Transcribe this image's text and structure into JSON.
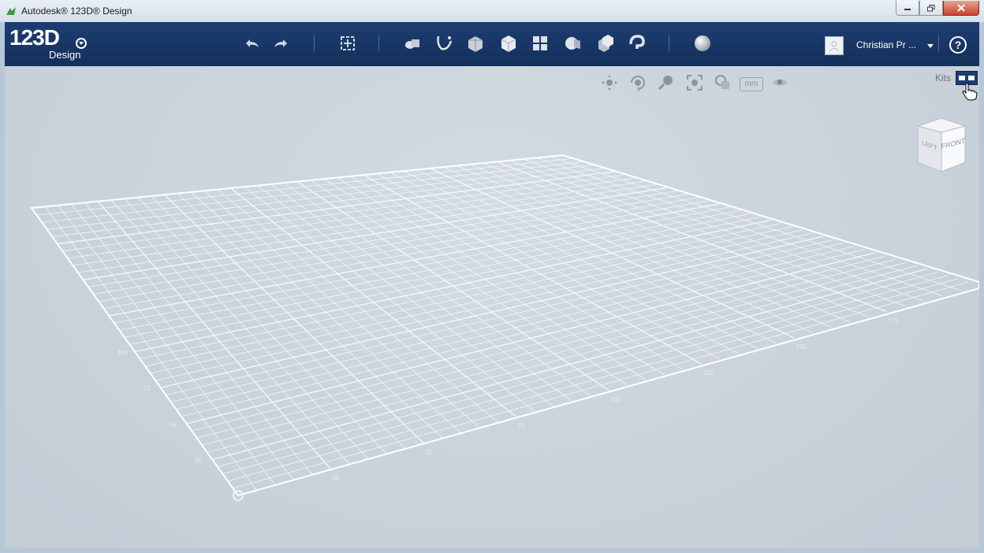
{
  "window": {
    "title": "Autodesk® 123D® Design",
    "controls": [
      "minimize",
      "maximize",
      "close"
    ]
  },
  "logo": {
    "main": "123D",
    "sub": "Design"
  },
  "toolbar": {
    "tools": [
      {
        "name": "undo-icon"
      },
      {
        "name": "redo-icon"
      },
      {
        "name": "transform-icon"
      },
      {
        "name": "primitives-icon"
      },
      {
        "name": "sketch-icon"
      },
      {
        "name": "construct-icon"
      },
      {
        "name": "modify-icon"
      },
      {
        "name": "pattern-icon"
      },
      {
        "name": "grouping-icon"
      },
      {
        "name": "combine-icon"
      },
      {
        "name": "measure-icon"
      },
      {
        "name": "material-icon"
      }
    ]
  },
  "user": {
    "name": "Christian Pr ..."
  },
  "help": {
    "label": "?"
  },
  "viewport": {
    "kits_label": "Kits",
    "units_label": "mm",
    "viewcube": {
      "front": "FRONT",
      "left": "LEFT"
    },
    "grid_labels_right": [
      "25",
      "50",
      "75",
      "100",
      "125",
      "150",
      "175"
    ],
    "grid_labels_left": [
      "25",
      "50",
      "75",
      "100"
    ]
  }
}
